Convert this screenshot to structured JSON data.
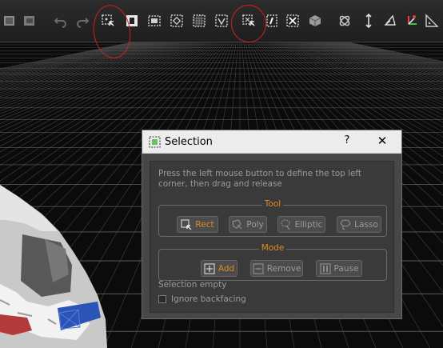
{
  "toolbar": {
    "buttons": [
      {
        "id": "toolbar-btn-a",
        "icon": "layer-icon"
      },
      {
        "id": "toolbar-btn-b",
        "icon": "layer-stack-icon"
      },
      {
        "id": "undo-button",
        "icon": "undo-icon"
      },
      {
        "id": "redo-button",
        "icon": "redo-icon"
      },
      {
        "id": "rect-select-button",
        "icon": "rect-select-icon"
      },
      {
        "id": "invert-select-button",
        "icon": "invert-select-icon"
      },
      {
        "id": "select-all-button",
        "icon": "select-all-icon"
      },
      {
        "id": "select-none-button",
        "icon": "select-none-icon"
      },
      {
        "id": "select-grid-button",
        "icon": "select-grid-icon"
      },
      {
        "id": "select-filter-button",
        "icon": "select-filter-icon"
      },
      {
        "id": "selection-tool-button",
        "icon": "selection-tool-icon"
      },
      {
        "id": "crop-button",
        "icon": "crop-icon"
      },
      {
        "id": "delete-selection-button",
        "icon": "delete-selection-icon"
      },
      {
        "id": "box-button",
        "icon": "box-icon"
      },
      {
        "id": "orbit-button",
        "icon": "orbit-icon"
      },
      {
        "id": "vertical-axis-button",
        "icon": "vertical-axis-icon"
      },
      {
        "id": "pose-button",
        "icon": "pose-icon"
      },
      {
        "id": "axes-button",
        "icon": "axes-icon"
      },
      {
        "id": "measure-button",
        "icon": "measure-icon"
      }
    ]
  },
  "dialog": {
    "title": "Selection",
    "help_label": "?",
    "close_label": "✕",
    "instructions": "Press the left mouse button to define the top left corner, then drag and release",
    "tool_group": {
      "label": "Tool",
      "options": [
        {
          "label": "Rect",
          "icon": "rect-tool-icon",
          "active": true
        },
        {
          "label": "Poly",
          "icon": "poly-tool-icon",
          "active": false
        },
        {
          "label": "Elliptic",
          "icon": "elliptic-tool-icon",
          "active": false
        },
        {
          "label": "Lasso",
          "icon": "lasso-tool-icon",
          "active": false
        }
      ]
    },
    "mode_group": {
      "label": "Mode",
      "options": [
        {
          "label": "Add",
          "icon": "add-mode-icon",
          "active": true
        },
        {
          "label": "Remove",
          "icon": "remove-mode-icon",
          "active": false
        },
        {
          "label": "Pause",
          "icon": "pause-mode-icon",
          "active": false
        }
      ]
    },
    "status": "Selection empty",
    "ignore_backfacing": {
      "label": "Ignore backfacing",
      "checked": false
    }
  },
  "colors": {
    "accent": "#e08a1e",
    "annotation": "#d21f1f",
    "dialog_bg": "#474747",
    "viewport_bg": "#0b0b0b"
  }
}
